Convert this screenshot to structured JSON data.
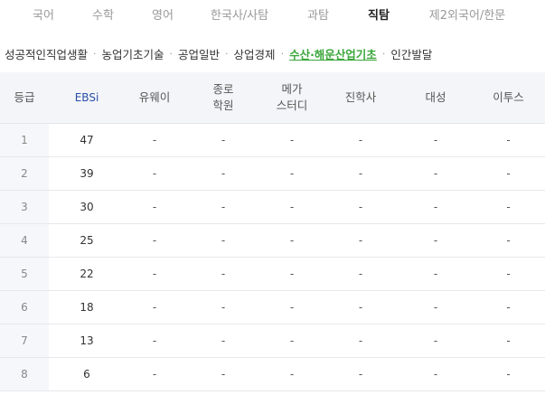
{
  "subject_tabs": [
    {
      "label": "국어",
      "active": false
    },
    {
      "label": "수학",
      "active": false
    },
    {
      "label": "영어",
      "active": false
    },
    {
      "label": "한국사/사탐",
      "active": false
    },
    {
      "label": "과탐",
      "active": false
    },
    {
      "label": "직탐",
      "active": true
    },
    {
      "label": "제2외국어/한문",
      "active": false
    }
  ],
  "sub_tabs": [
    {
      "label": "성공적인직업생활",
      "active": false
    },
    {
      "label": "농업기초기술",
      "active": false
    },
    {
      "label": "공업일반",
      "active": false
    },
    {
      "label": "상업경제",
      "active": false
    },
    {
      "label": "수산·해운산업기초",
      "active": true
    },
    {
      "label": "인간발달",
      "active": false
    }
  ],
  "sub_tab_separator": "·",
  "table": {
    "headers": [
      "등급",
      "EBSi",
      "유웨이",
      "종로\n학원",
      "메가\n스터디",
      "진학사",
      "대성",
      "이투스"
    ],
    "rows": [
      [
        "1",
        "47",
        "-",
        "-",
        "-",
        "-",
        "-",
        "-"
      ],
      [
        "2",
        "39",
        "-",
        "-",
        "-",
        "-",
        "-",
        "-"
      ],
      [
        "3",
        "30",
        "-",
        "-",
        "-",
        "-",
        "-",
        "-"
      ],
      [
        "4",
        "25",
        "-",
        "-",
        "-",
        "-",
        "-",
        "-"
      ],
      [
        "5",
        "22",
        "-",
        "-",
        "-",
        "-",
        "-",
        "-"
      ],
      [
        "6",
        "18",
        "-",
        "-",
        "-",
        "-",
        "-",
        "-"
      ],
      [
        "7",
        "13",
        "-",
        "-",
        "-",
        "-",
        "-",
        "-"
      ],
      [
        "8",
        "6",
        "-",
        "-",
        "-",
        "-",
        "-",
        "-"
      ]
    ]
  },
  "colors": {
    "active_subtab": "#3aa63a",
    "ebsi_header": "#2a4fa8",
    "header_bg": "#f3f5f8"
  }
}
